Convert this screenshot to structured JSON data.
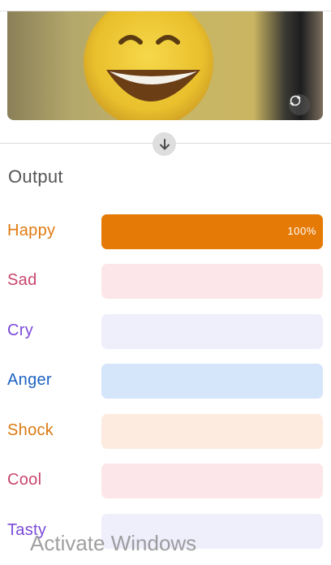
{
  "camera": {
    "switch_icon": "camera-switch-icon",
    "expand_icon": "arrow-down-icon"
  },
  "output": {
    "title": "Output",
    "emotions": [
      {
        "label": "Happy",
        "value": 1.0,
        "percent_text": "100%",
        "label_color": "#e07b12",
        "track_color": "#e57a06",
        "fill_color": "#e57a06"
      },
      {
        "label": "Sad",
        "value": 0.0,
        "percent_text": "",
        "label_color": "#c9466d",
        "track_color": "#fde6ea",
        "fill_color": "#e26d8e"
      },
      {
        "label": "Cry",
        "value": 0.0,
        "percent_text": "",
        "label_color": "#7b49d8",
        "track_color": "#efeffc",
        "fill_color": "#8a6be0"
      },
      {
        "label": "Anger",
        "value": 0.0,
        "percent_text": "",
        "label_color": "#1d63c2",
        "track_color": "#d5e5fa",
        "fill_color": "#3d7fd6"
      },
      {
        "label": "Shock",
        "value": 0.0,
        "percent_text": "",
        "label_color": "#db7a12",
        "track_color": "#fdebe0",
        "fill_color": "#e88a2e"
      },
      {
        "label": "Cool",
        "value": 0.0,
        "percent_text": "",
        "label_color": "#c9466d",
        "track_color": "#fde6ea",
        "fill_color": "#e26d8e"
      },
      {
        "label": "Tasty",
        "value": 0.0,
        "percent_text": "",
        "label_color": "#7b49d8",
        "track_color": "#efeffc",
        "fill_color": "#8a6be0"
      }
    ]
  },
  "watermark": {
    "text": "Activate Windows"
  }
}
